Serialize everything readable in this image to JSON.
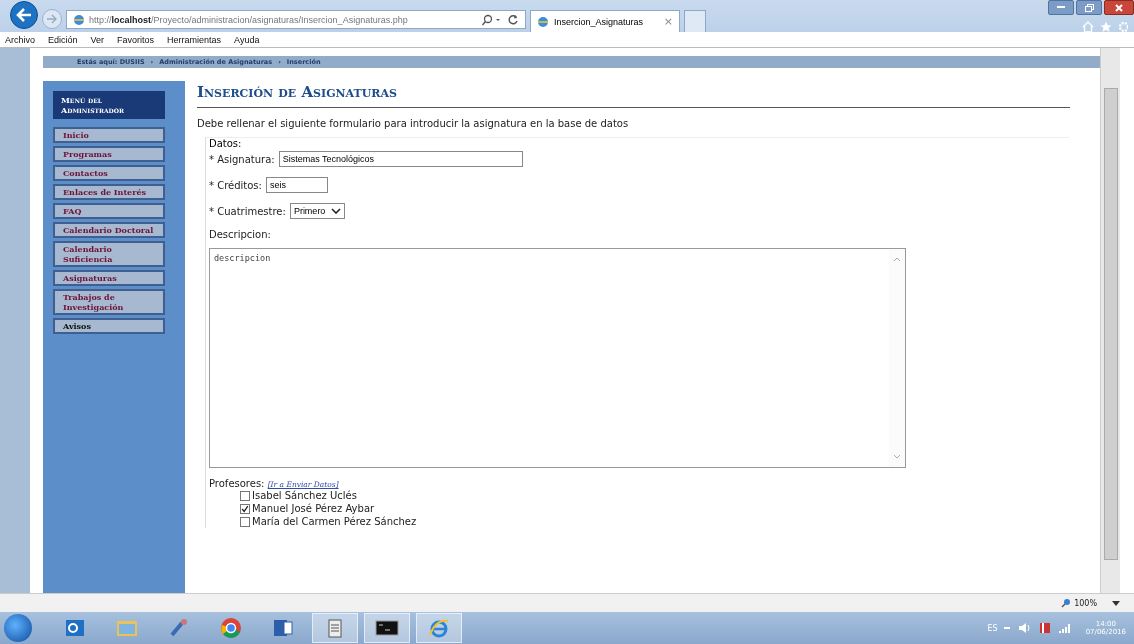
{
  "browser": {
    "address_scheme": "http://",
    "address_host": "localhost",
    "address_path": "/Proyecto/administracion/asignaturas/Insercion_Asignaturas.php",
    "tab_title": "Insercion_Asignaturas",
    "tab_close": "×",
    "menu": [
      "Archivo",
      "Edición",
      "Ver",
      "Favoritos",
      "Herramientas",
      "Ayuda"
    ]
  },
  "breadcrumb": [
    "Estás aquí: DUSIIS",
    "›",
    "Administración de Asignaturas",
    "›",
    "Inserción"
  ],
  "sidebar": {
    "title": "Menú del Administrador",
    "items": [
      {
        "label": "Inicio",
        "selected": false
      },
      {
        "label": "Programas",
        "selected": false
      },
      {
        "label": "Contactos",
        "selected": false
      },
      {
        "label": "Enlaces de Interés",
        "selected": false
      },
      {
        "label": "FAQ",
        "selected": false
      },
      {
        "label": "Calendario Doctoral",
        "selected": false
      },
      {
        "label": "Calendario Suficiencia",
        "selected": false
      },
      {
        "label": "Asignaturas",
        "selected": false
      },
      {
        "label": "Trabajos de Investigación",
        "selected": false
      },
      {
        "label": "Avisos",
        "selected": true
      }
    ]
  },
  "page_title": "Inserción de Asignaturas",
  "intro": "Debe rellenar el siguiente formulario para introducir la asignatura en la base de datos",
  "form": {
    "legend": "Datos:",
    "asignatura": {
      "label": "* Asignatura:",
      "value": "Sistemas Tecnológicos"
    },
    "creditos": {
      "label": "* Créditos:",
      "value": "seis"
    },
    "cuatrimestre": {
      "label": "* Cuatrimestre:",
      "value": "Primero"
    },
    "descripcion": {
      "label": "Descripcion:",
      "value": "descripcion"
    },
    "profesores": {
      "label": "Profesores:",
      "link": "[Ir a Enviar Datos]",
      "items": [
        {
          "name": "Isabel Sánchez Uclés",
          "checked": false
        },
        {
          "name": "Manuel José Pérez Aybar",
          "checked": true
        },
        {
          "name": "María del Carmen Pérez Sánchez",
          "checked": false
        }
      ]
    }
  },
  "status_bar": {
    "zoom": "100%"
  },
  "taskbar": {
    "language": "ES",
    "time": "14:00",
    "date": "07/06/2016"
  }
}
